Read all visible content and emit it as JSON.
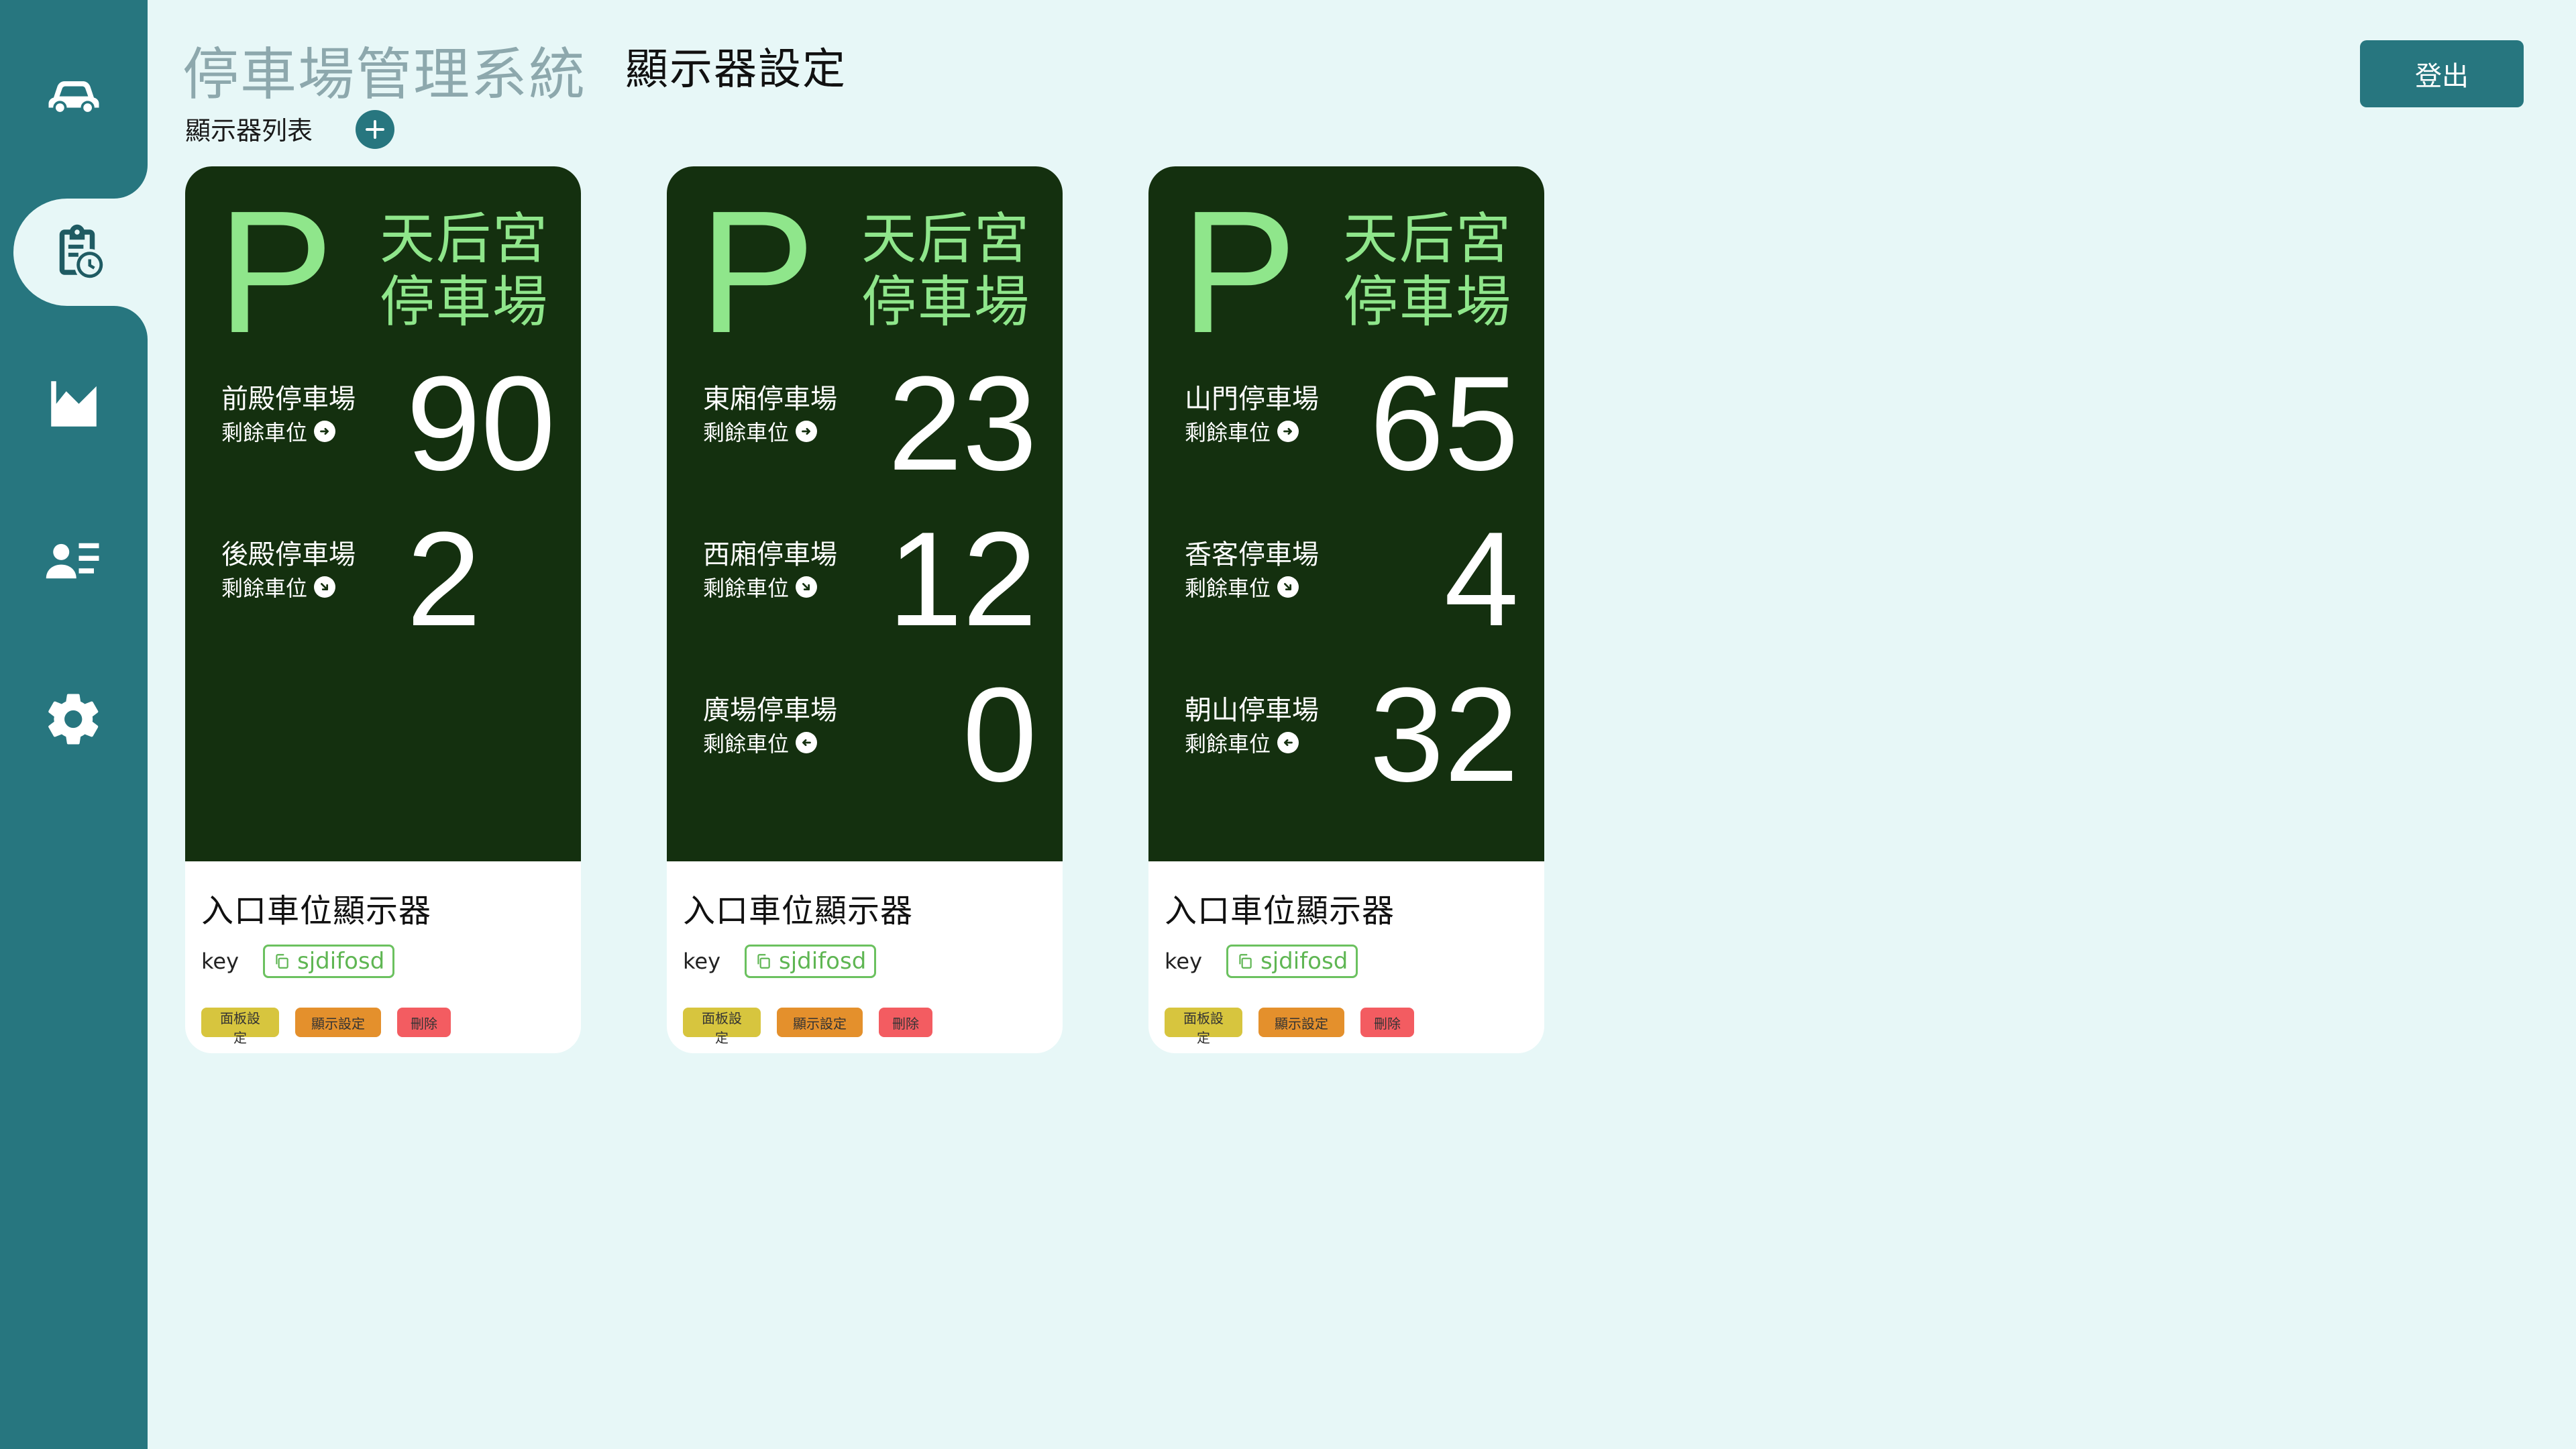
{
  "app": {
    "title": "停車場管理系統",
    "page_title": "顯示器設定",
    "logout_label": "登出"
  },
  "sidebar": {
    "items": [
      {
        "name": "car-icon",
        "active": false
      },
      {
        "name": "clipboard-clock-icon",
        "active": true
      },
      {
        "name": "area-chart-icon",
        "active": false
      },
      {
        "name": "user-list-icon",
        "active": false
      },
      {
        "name": "gear-icon",
        "active": false
      }
    ]
  },
  "list": {
    "label": "顯示器列表",
    "add_label": "+"
  },
  "colors": {
    "sidebar": "#27767f",
    "board": "#14300f",
    "accent_green": "#8fe68b"
  },
  "cards": [
    {
      "p_letter": "P",
      "name_line1": "天后宮",
      "name_line2": "停車場",
      "lots": [
        {
          "name": "前殿停車場",
          "sub": "剩餘車位",
          "arrow": "right",
          "count": "90"
        },
        {
          "name": "後殿停車場",
          "sub": "剩餘車位",
          "arrow": "down-right",
          "count": "2"
        }
      ],
      "display_name": "入口車位顯示器",
      "key_label": "key",
      "key_value": "sjdifosd",
      "btn_panel": "面板設定",
      "btn_display": "顯示設定",
      "btn_delete": "刪除"
    },
    {
      "p_letter": "P",
      "name_line1": "天后宮",
      "name_line2": "停車場",
      "lots": [
        {
          "name": "東廂停車場",
          "sub": "剩餘車位",
          "arrow": "right",
          "count": "23"
        },
        {
          "name": "西廂停車場",
          "sub": "剩餘車位",
          "arrow": "down-right",
          "count": "12"
        },
        {
          "name": "廣場停車場",
          "sub": "剩餘車位",
          "arrow": "left",
          "count": "0"
        }
      ],
      "display_name": "入口車位顯示器",
      "key_label": "key",
      "key_value": "sjdifosd",
      "btn_panel": "面板設定",
      "btn_display": "顯示設定",
      "btn_delete": "刪除"
    },
    {
      "p_letter": "P",
      "name_line1": "天后宮",
      "name_line2": "停車場",
      "lots": [
        {
          "name": "山門停車場",
          "sub": "剩餘車位",
          "arrow": "right",
          "count": "65"
        },
        {
          "name": "香客停車場",
          "sub": "剩餘車位",
          "arrow": "down-right",
          "count": "4"
        },
        {
          "name": "朝山停車場",
          "sub": "剩餘車位",
          "arrow": "left",
          "count": "32"
        }
      ],
      "display_name": "入口車位顯示器",
      "key_label": "key",
      "key_value": "sjdifosd",
      "btn_panel": "面板設定",
      "btn_display": "顯示設定",
      "btn_delete": "刪除"
    }
  ]
}
